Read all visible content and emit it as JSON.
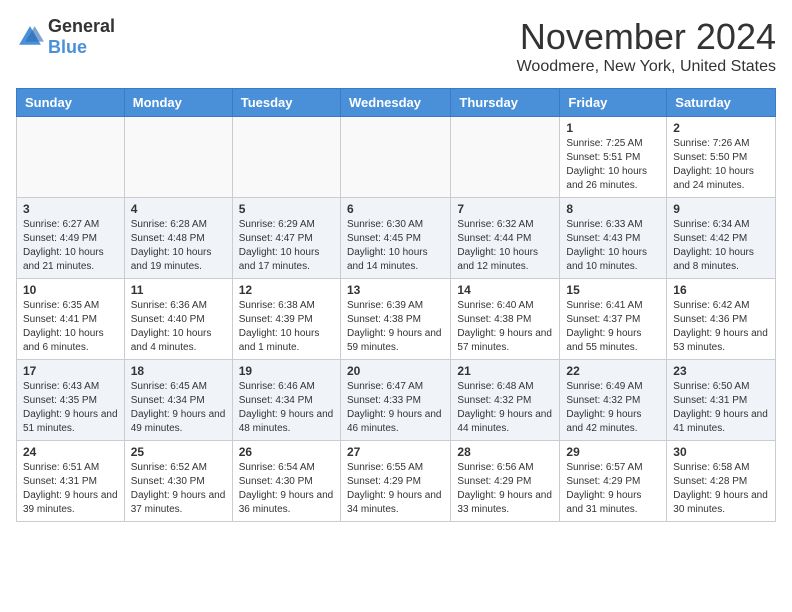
{
  "logo": {
    "general": "General",
    "blue": "Blue"
  },
  "header": {
    "month_year": "November 2024",
    "location": "Woodmere, New York, United States"
  },
  "weekdays": [
    "Sunday",
    "Monday",
    "Tuesday",
    "Wednesday",
    "Thursday",
    "Friday",
    "Saturday"
  ],
  "weeks": [
    [
      {
        "day": "",
        "info": ""
      },
      {
        "day": "",
        "info": ""
      },
      {
        "day": "",
        "info": ""
      },
      {
        "day": "",
        "info": ""
      },
      {
        "day": "",
        "info": ""
      },
      {
        "day": "1",
        "info": "Sunrise: 7:25 AM\nSunset: 5:51 PM\nDaylight: 10 hours and 26 minutes."
      },
      {
        "day": "2",
        "info": "Sunrise: 7:26 AM\nSunset: 5:50 PM\nDaylight: 10 hours and 24 minutes."
      }
    ],
    [
      {
        "day": "3",
        "info": "Sunrise: 6:27 AM\nSunset: 4:49 PM\nDaylight: 10 hours and 21 minutes."
      },
      {
        "day": "4",
        "info": "Sunrise: 6:28 AM\nSunset: 4:48 PM\nDaylight: 10 hours and 19 minutes."
      },
      {
        "day": "5",
        "info": "Sunrise: 6:29 AM\nSunset: 4:47 PM\nDaylight: 10 hours and 17 minutes."
      },
      {
        "day": "6",
        "info": "Sunrise: 6:30 AM\nSunset: 4:45 PM\nDaylight: 10 hours and 14 minutes."
      },
      {
        "day": "7",
        "info": "Sunrise: 6:32 AM\nSunset: 4:44 PM\nDaylight: 10 hours and 12 minutes."
      },
      {
        "day": "8",
        "info": "Sunrise: 6:33 AM\nSunset: 4:43 PM\nDaylight: 10 hours and 10 minutes."
      },
      {
        "day": "9",
        "info": "Sunrise: 6:34 AM\nSunset: 4:42 PM\nDaylight: 10 hours and 8 minutes."
      }
    ],
    [
      {
        "day": "10",
        "info": "Sunrise: 6:35 AM\nSunset: 4:41 PM\nDaylight: 10 hours and 6 minutes."
      },
      {
        "day": "11",
        "info": "Sunrise: 6:36 AM\nSunset: 4:40 PM\nDaylight: 10 hours and 4 minutes."
      },
      {
        "day": "12",
        "info": "Sunrise: 6:38 AM\nSunset: 4:39 PM\nDaylight: 10 hours and 1 minute."
      },
      {
        "day": "13",
        "info": "Sunrise: 6:39 AM\nSunset: 4:38 PM\nDaylight: 9 hours and 59 minutes."
      },
      {
        "day": "14",
        "info": "Sunrise: 6:40 AM\nSunset: 4:38 PM\nDaylight: 9 hours and 57 minutes."
      },
      {
        "day": "15",
        "info": "Sunrise: 6:41 AM\nSunset: 4:37 PM\nDaylight: 9 hours and 55 minutes."
      },
      {
        "day": "16",
        "info": "Sunrise: 6:42 AM\nSunset: 4:36 PM\nDaylight: 9 hours and 53 minutes."
      }
    ],
    [
      {
        "day": "17",
        "info": "Sunrise: 6:43 AM\nSunset: 4:35 PM\nDaylight: 9 hours and 51 minutes."
      },
      {
        "day": "18",
        "info": "Sunrise: 6:45 AM\nSunset: 4:34 PM\nDaylight: 9 hours and 49 minutes."
      },
      {
        "day": "19",
        "info": "Sunrise: 6:46 AM\nSunset: 4:34 PM\nDaylight: 9 hours and 48 minutes."
      },
      {
        "day": "20",
        "info": "Sunrise: 6:47 AM\nSunset: 4:33 PM\nDaylight: 9 hours and 46 minutes."
      },
      {
        "day": "21",
        "info": "Sunrise: 6:48 AM\nSunset: 4:32 PM\nDaylight: 9 hours and 44 minutes."
      },
      {
        "day": "22",
        "info": "Sunrise: 6:49 AM\nSunset: 4:32 PM\nDaylight: 9 hours and 42 minutes."
      },
      {
        "day": "23",
        "info": "Sunrise: 6:50 AM\nSunset: 4:31 PM\nDaylight: 9 hours and 41 minutes."
      }
    ],
    [
      {
        "day": "24",
        "info": "Sunrise: 6:51 AM\nSunset: 4:31 PM\nDaylight: 9 hours and 39 minutes."
      },
      {
        "day": "25",
        "info": "Sunrise: 6:52 AM\nSunset: 4:30 PM\nDaylight: 9 hours and 37 minutes."
      },
      {
        "day": "26",
        "info": "Sunrise: 6:54 AM\nSunset: 4:30 PM\nDaylight: 9 hours and 36 minutes."
      },
      {
        "day": "27",
        "info": "Sunrise: 6:55 AM\nSunset: 4:29 PM\nDaylight: 9 hours and 34 minutes."
      },
      {
        "day": "28",
        "info": "Sunrise: 6:56 AM\nSunset: 4:29 PM\nDaylight: 9 hours and 33 minutes."
      },
      {
        "day": "29",
        "info": "Sunrise: 6:57 AM\nSunset: 4:29 PM\nDaylight: 9 hours and 31 minutes."
      },
      {
        "day": "30",
        "info": "Sunrise: 6:58 AM\nSunset: 4:28 PM\nDaylight: 9 hours and 30 minutes."
      }
    ]
  ]
}
